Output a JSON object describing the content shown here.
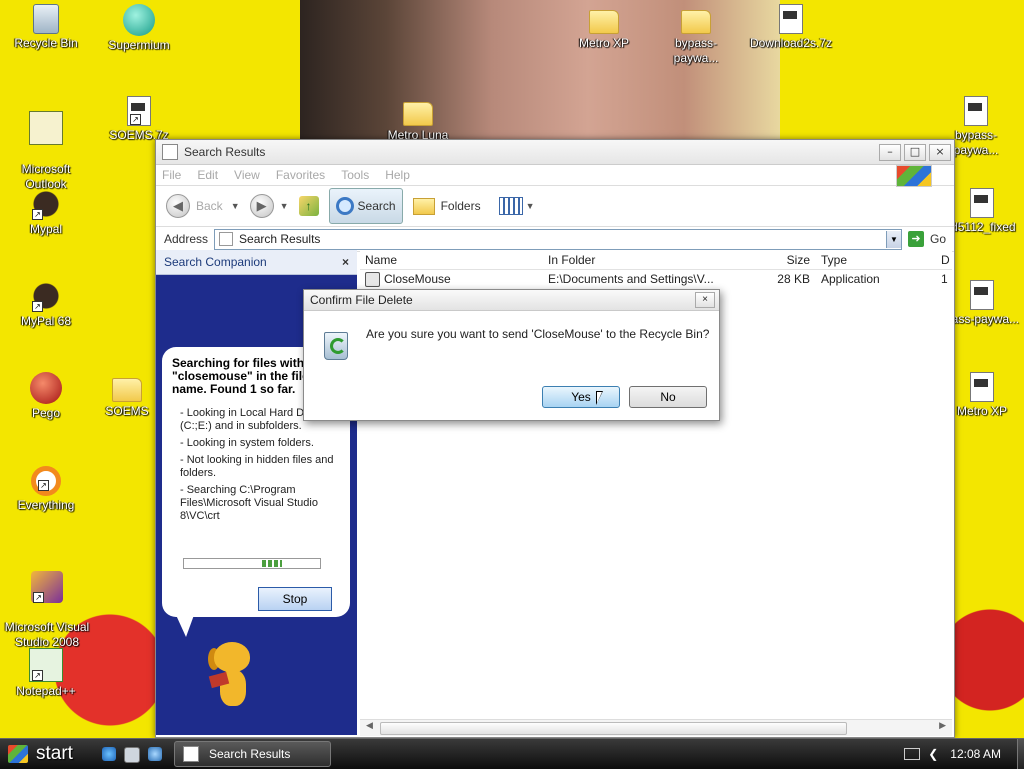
{
  "desktop": {
    "icons": [
      {
        "label": "Recycle Bin",
        "icon": "recycle-bin-icon"
      },
      {
        "label": "Supermium",
        "icon": "supermium-icon"
      },
      {
        "label": "Microsoft\nOutlook",
        "icon": "outlook-icon"
      },
      {
        "label": "SOEMS.7z",
        "icon": "archive-file-icon"
      },
      {
        "label": "Mypal",
        "icon": "mypal-icon"
      },
      {
        "label": "MyPal 68",
        "icon": "mypal-icon"
      },
      {
        "label": "Pego",
        "icon": "pego-icon"
      },
      {
        "label": "SOEMS",
        "icon": "folder-icon"
      },
      {
        "label": "Everything",
        "icon": "everything-icon"
      },
      {
        "label": "Microsoft Visual\nStudio 2008",
        "icon": "visual-studio-icon"
      },
      {
        "label": "Notepad++",
        "icon": "notepadpp-icon"
      },
      {
        "label": "Metro XP",
        "icon": "folder-icon"
      },
      {
        "label": "bypass-paywa...",
        "icon": "folder-icon"
      },
      {
        "label": "Download2s.7z",
        "icon": "archive-file-icon"
      },
      {
        "label": "Metro Luna",
        "icon": "folder-icon"
      },
      {
        "label": "bypass-paywa...",
        "icon": "archive-file-icon"
      },
      {
        "label": "ld5112_fixed",
        "icon": "archive-file-icon"
      },
      {
        "label": "pass-paywa...",
        "icon": "archive-file-icon"
      },
      {
        "label": "Metro XP",
        "icon": "archive-file-icon"
      }
    ]
  },
  "window": {
    "title": "Search Results",
    "minimize": "–",
    "maximize": "□",
    "close": "×",
    "menu": [
      "File",
      "Edit",
      "View",
      "Favorites",
      "Tools",
      "Help"
    ],
    "toolbar": {
      "back_label": "Back",
      "search_label": "Search",
      "folders_label": "Folders"
    },
    "address": {
      "label": "Address",
      "value": "Search Results",
      "go_label": "Go"
    },
    "companion": {
      "title": "Search Companion",
      "close": "×",
      "status": "Searching for files with \"closemouse\" in the file name.  Found 1 so far.",
      "details": [
        "- Looking in Local Hard Drives (C:;E:) and in subfolders.",
        "- Looking in system folders.",
        "- Not looking in hidden files and folders.",
        "- Searching C:\\Program Files\\Microsoft Visual Studio 8\\VC\\crt"
      ],
      "stop_label": "Stop"
    },
    "results": {
      "columns": [
        "Name",
        "In Folder",
        "Size",
        "Type",
        "D"
      ],
      "rows": [
        {
          "name": "CloseMouse",
          "folder": "E:\\Documents and Settings\\V...",
          "size": "28 KB",
          "type": "Application",
          "date": "1"
        }
      ]
    }
  },
  "dialog": {
    "title": "Confirm File Delete",
    "close": "×",
    "message": "Are you sure you want to send 'CloseMouse' to the Recycle Bin?",
    "yes_label": "Yes",
    "no_label": "No"
  },
  "taskbar": {
    "start_label": "start",
    "task_label": "Search Results",
    "clock": "12:08 AM"
  }
}
